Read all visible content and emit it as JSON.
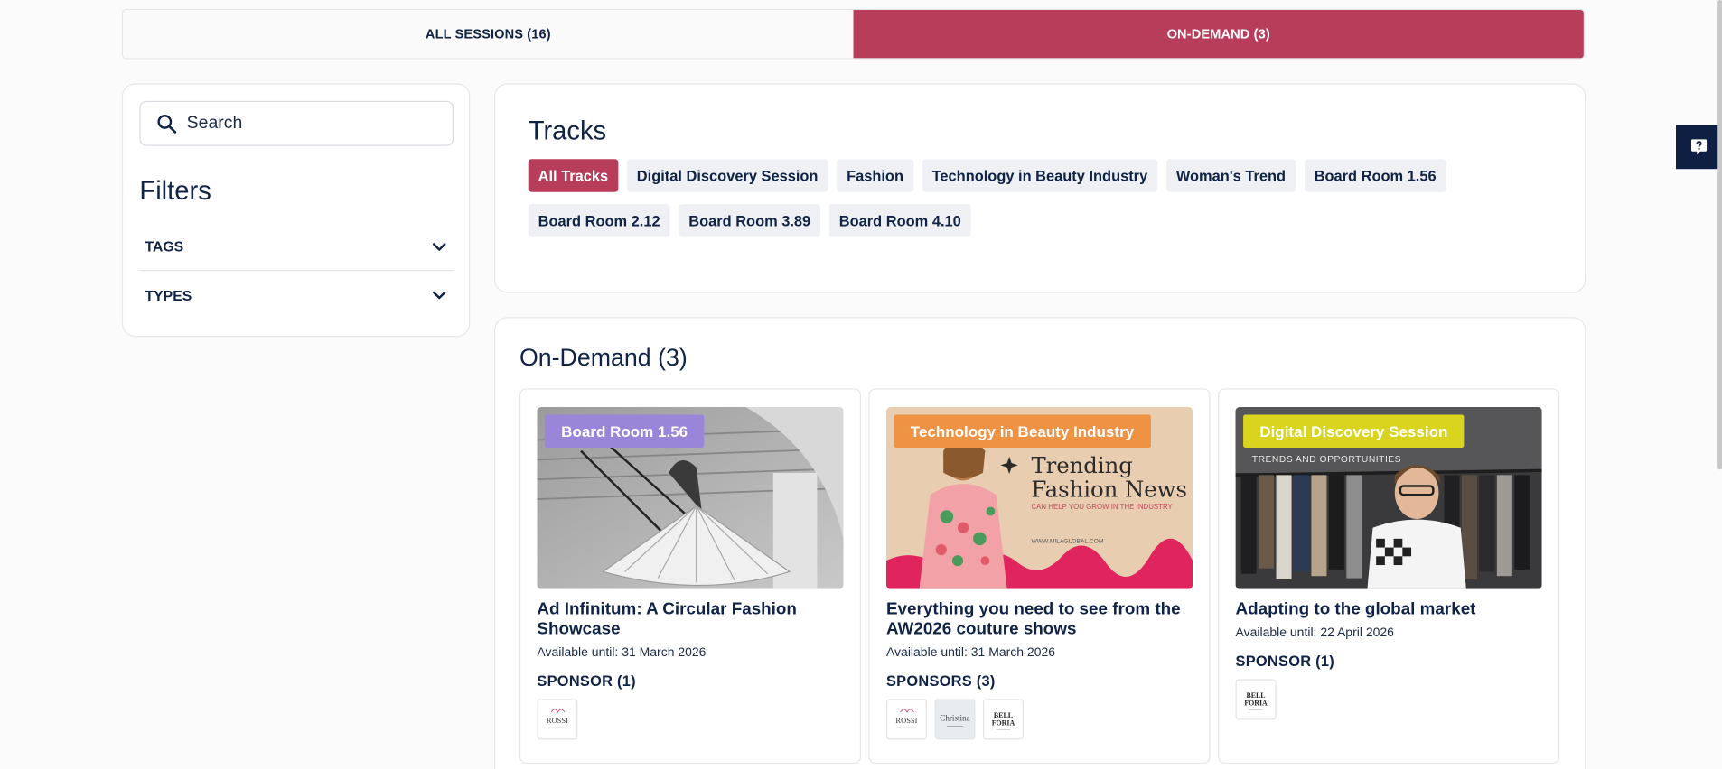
{
  "tabs": [
    {
      "label": "ALL SESSIONS (16)",
      "active": false
    },
    {
      "label": "ON-DEMAND (3)",
      "active": true
    }
  ],
  "sidebar": {
    "search_placeholder": "Search",
    "filters_title": "Filters",
    "filters": [
      {
        "label": "TAGS"
      },
      {
        "label": "TYPES"
      }
    ]
  },
  "tracks": {
    "title": "Tracks",
    "chips": [
      {
        "label": "All Tracks",
        "active": true
      },
      {
        "label": "Digital Discovery Session",
        "active": false
      },
      {
        "label": "Fashion",
        "active": false
      },
      {
        "label": "Technology in Beauty Industry",
        "active": false
      },
      {
        "label": "Woman's Trend",
        "active": false
      },
      {
        "label": "Board Room 1.56",
        "active": false
      },
      {
        "label": "Board Room 2.12",
        "active": false
      },
      {
        "label": "Board Room 3.89",
        "active": false
      },
      {
        "label": "Board Room 4.10",
        "active": false
      }
    ]
  },
  "on_demand": {
    "title": "On-Demand (3)",
    "sessions": [
      {
        "badge": "Board Room 1.56",
        "badge_color": "#9a86d8",
        "title": "Ad Infinitum: A Circular Fashion Showcase",
        "available": "Available until: 31 March 2026",
        "sponsor_label": "SPONSOR (1)",
        "sponsors": [
          "rossi-logo"
        ]
      },
      {
        "badge": "Technology in Beauty Industry",
        "badge_color": "#ee9244",
        "title": "Everything you need to see from the AW2026 couture shows",
        "available": "Available until: 31 March 2026",
        "sponsor_label": "SPONSORS (3)",
        "sponsors": [
          "rossi-logo",
          "christina-logo",
          "bellforia-logo"
        ],
        "image_text": {
          "headline1": "Trending",
          "headline2": "Fashion News",
          "sub": "CAN HELP YOU GROW IN THE INDUSTRY",
          "url": "WWW.MILAGLOBAL.COM"
        }
      },
      {
        "badge": "Digital Discovery Session",
        "badge_color": "#d9d41e",
        "title": "Adapting to the global market",
        "available": "Available until: 22 April 2026",
        "sponsor_label": "SPONSOR (1)",
        "sponsors": [
          "bellforia-logo"
        ],
        "image_text": {
          "overlay": "TRENDS AND OPPORTUNITIES"
        }
      }
    ]
  },
  "logo_text": {
    "rossi": "ROSSI",
    "christina": "Christina",
    "bell": "BELL",
    "foria": "FORIA"
  },
  "colors": {
    "accent": "#b83d5b",
    "navy": "#0f2346",
    "chip_bg": "#eef0f3"
  },
  "help_icon": "question-icon"
}
